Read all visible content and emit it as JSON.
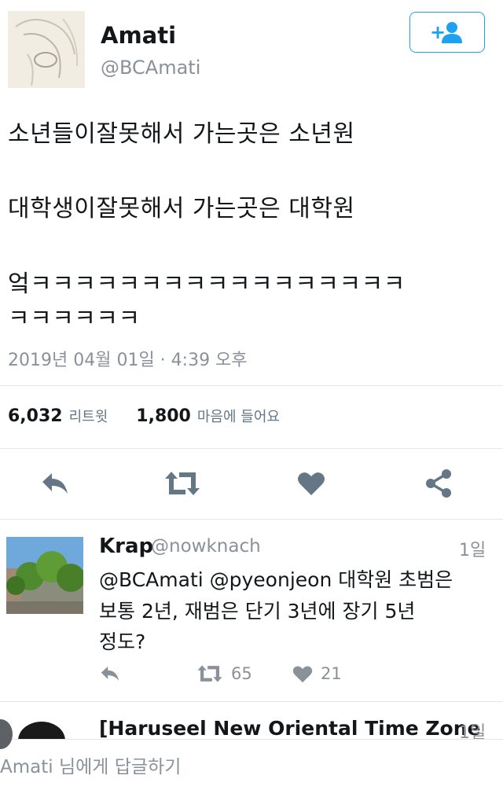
{
  "tweet": {
    "author_name": "Amati",
    "author_handle": "@BCAmati",
    "lines": [
      "소년들이잘못해서 가는곳은 소년원",
      "대학생이잘못해서 가는곳은 대학원",
      "엌ㅋㅋㅋㅋㅋㅋㅋㅋㅋㅋㅋㅋㅋㅋㅋㅋㅋ",
      "ㅋㅋㅋㅋㅋㅋ"
    ],
    "timestamp": "2019년 04월 01일 · 4:39 오후",
    "retweet_count": "6,032",
    "retweet_label": "리트윗",
    "like_count": "1,800",
    "like_label": "마음에 들어요"
  },
  "actions": [
    "reply-icon",
    "retweet-icon",
    "heart-icon",
    "share-icon"
  ],
  "reply": {
    "author_name": "Krap",
    "author_handle": "@nowknach",
    "time": "1일",
    "lines": [
      "@BCAmati @pyeonjeon 대학원 초범은",
      "보통 2년, 재범은 단기 3년에 장기 5년",
      "정도?"
    ],
    "retweet_count": "65",
    "like_count": "21"
  },
  "next_tweet": {
    "author_name": "[Haruseel New Oriental Time Zone",
    "time": "1일"
  },
  "composer": {
    "placeholder": "Amati 님에게 답글하기"
  },
  "colors": {
    "accent": "#1da1f2",
    "icon_gray": "#657786",
    "muted_text": "#8a9199",
    "divider": "#e1e8ed"
  }
}
